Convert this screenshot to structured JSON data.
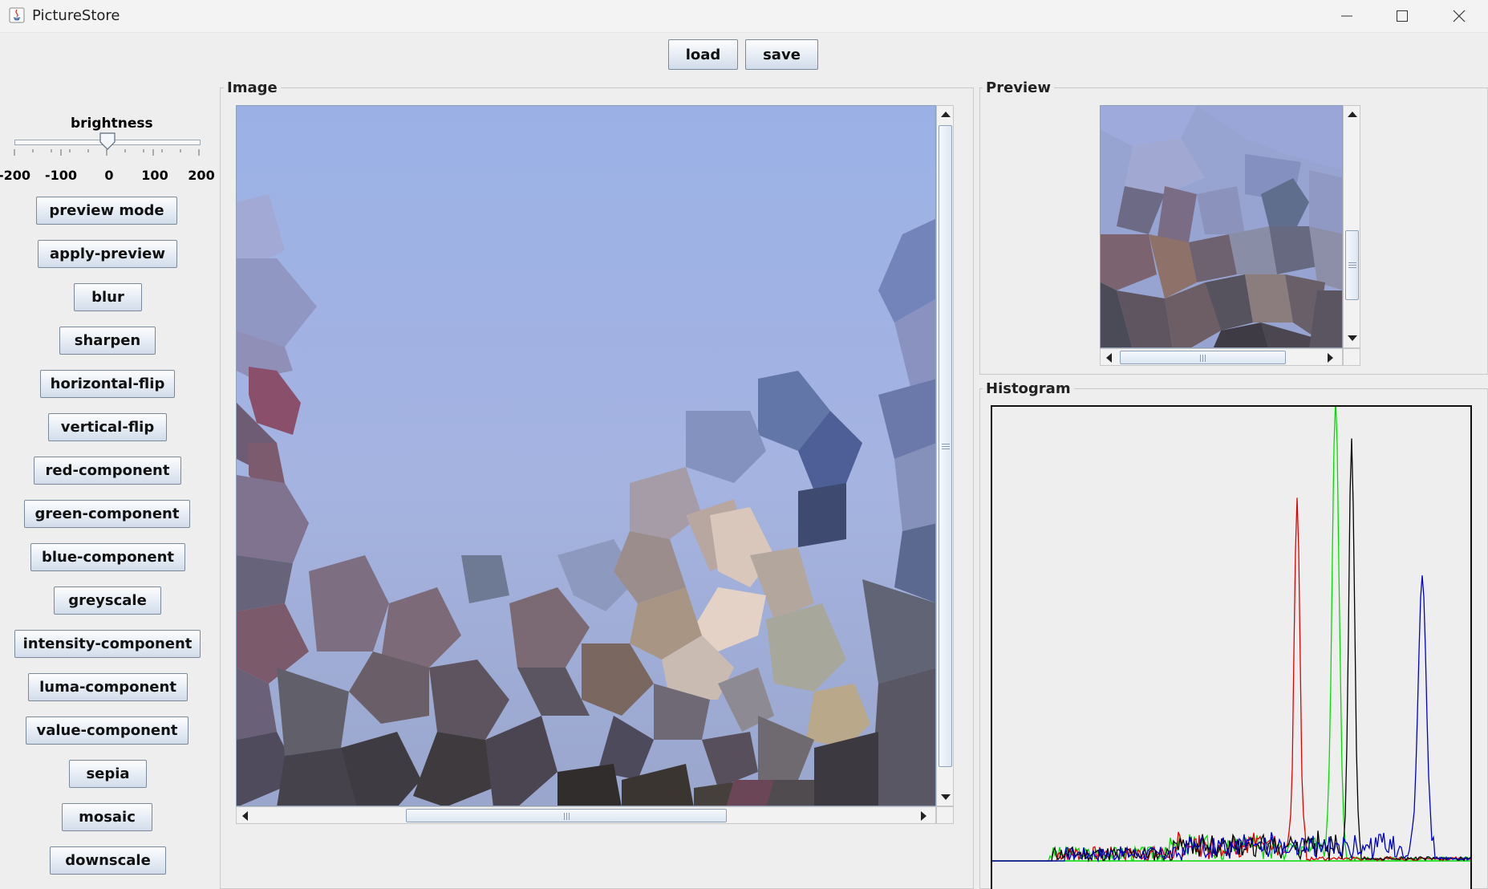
{
  "window": {
    "title": "PictureStore"
  },
  "toolbar": {
    "load": "load",
    "save": "save"
  },
  "brightness": {
    "label": "brightness",
    "value": 0,
    "min": -200,
    "max": 200,
    "ticks": [
      "-200",
      "-100",
      "0",
      "100",
      "200"
    ]
  },
  "sidebar": {
    "buttons": [
      "preview mode",
      "apply-preview",
      "blur",
      "sharpen",
      "horizontal-flip",
      "vertical-flip",
      "red-component",
      "green-component",
      "blue-component",
      "greyscale",
      "intensity-component",
      "luma-component",
      "value-component",
      "sepia",
      "mosaic",
      "downscale"
    ]
  },
  "panels": {
    "image": "Image",
    "preview": "Preview",
    "histogram": "Histogram"
  },
  "colors": {
    "red": "#e00000",
    "green": "#00dd00",
    "blue": "#0000cc",
    "black": "#000000"
  }
}
